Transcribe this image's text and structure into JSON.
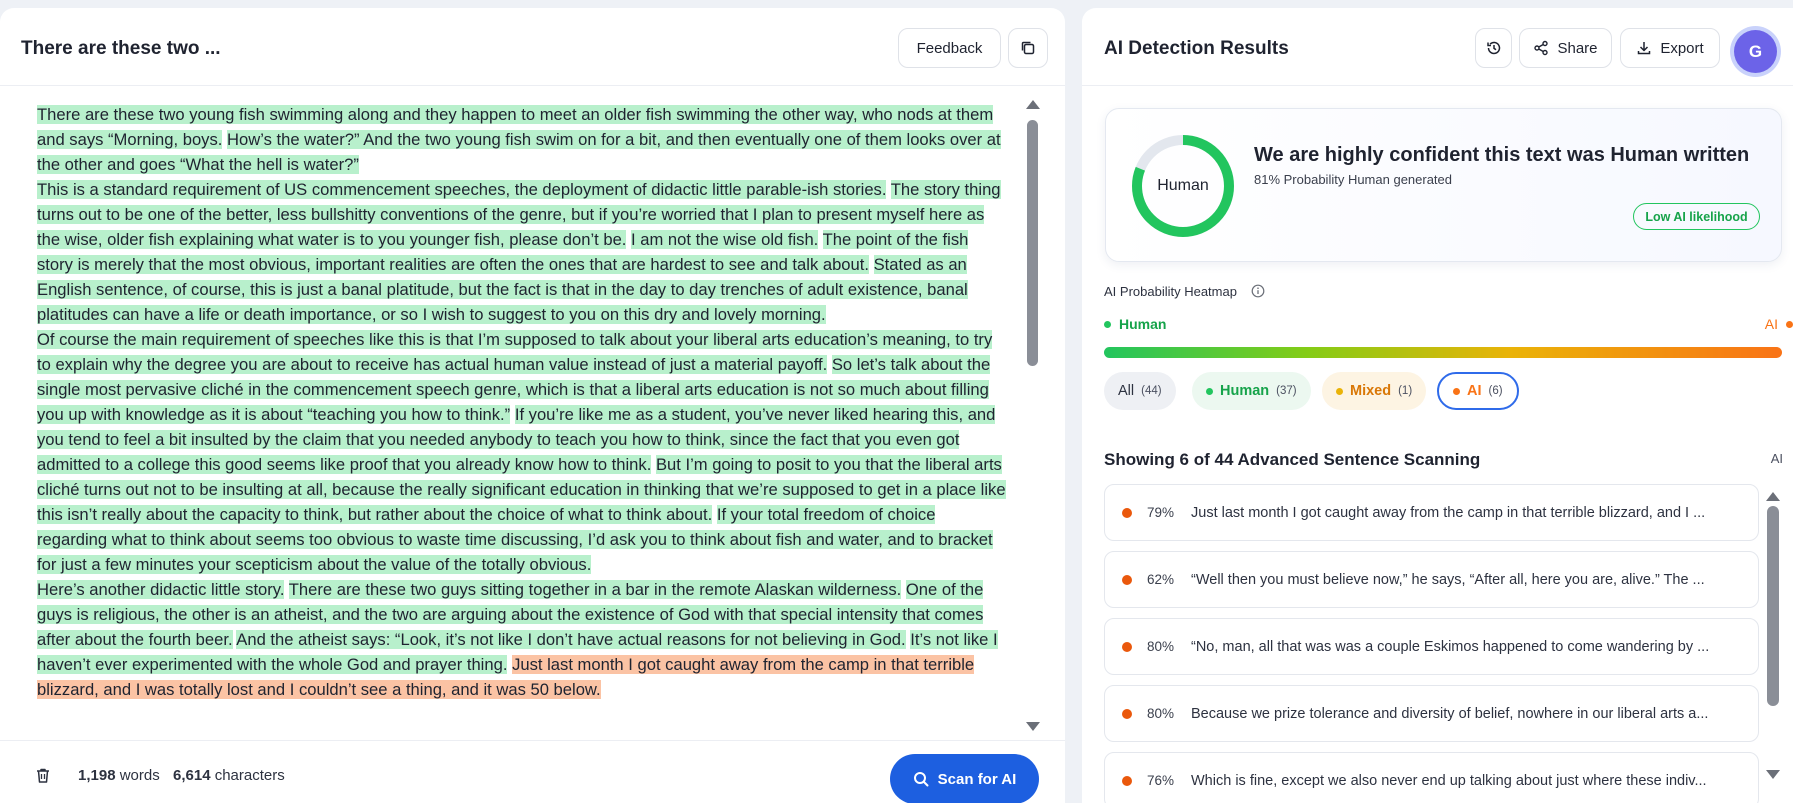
{
  "left": {
    "title": "There are these two ...",
    "feedback_label": "Feedback",
    "paragraphs": [
      [
        {
          "t": "There are these two young fish swimming along and they happen to meet an older fish swimming the other way, who nods at them and says “Morning, boys.",
          "c": "h"
        },
        {
          "t": " ",
          "c": ""
        },
        {
          "t": "How’s the water?” And the two young fish swim on for a bit, and then eventually one of them looks over at the other and goes “What the hell is water?”",
          "c": "h"
        }
      ],
      [
        {
          "t": "This is a standard requirement of US commencement speeches, the deployment of didactic little parable-ish stories.",
          "c": "h"
        },
        {
          "t": " ",
          "c": ""
        },
        {
          "t": "The story thing turns out to be one of the better, less bullshitty conventions of the genre, but if you’re worried that I plan to present myself here as the wise, older fish explaining what water is to you younger fish, please don’t be.",
          "c": "h"
        },
        {
          "t": " ",
          "c": ""
        },
        {
          "t": "I am not the wise old fish.",
          "c": "h"
        },
        {
          "t": " ",
          "c": ""
        },
        {
          "t": "The point of the fish story is merely that the most obvious, important realities are often the ones that are hardest to see and talk about.",
          "c": "h"
        },
        {
          "t": " ",
          "c": ""
        },
        {
          "t": "Stated as an English sentence, of course, this is just a banal platitude, but the fact is that in the day to day trenches of adult existence, banal platitudes can have a life or death importance, or so I wish to suggest to you on this dry and lovely morning.",
          "c": "h"
        }
      ],
      [
        {
          "t": "Of course the main requirement of speeches like this is that I’m supposed to talk about your liberal arts education’s mean­ing, to try to explain why the degree you are about to receive has actual human value instead of just a material payoff.",
          "c": "h"
        },
        {
          "t": " ",
          "c": ""
        },
        {
          "t": "So let’s talk about the single most pervasive cliché in the commencement speech genre, which is that a liberal arts education is not so much about filling you up with knowledge as it is about “teaching you how to think.”",
          "c": "h"
        },
        {
          "t": " ",
          "c": ""
        },
        {
          "t": "If you’re like me as a student, you’ve never liked hearing this, and you tend to feel a bit insulted by the claim that you needed anybody to teach you how to think, since the fact that you even got admitted to a college this good seems like proof that you already know how to think.",
          "c": "h"
        },
        {
          "t": " ",
          "c": ""
        },
        {
          "t": "But I’m going to posit to you that the liberal arts cliché turns out not to be insulting at all, because the really signifi­cant education in thinking that we’re supposed to get in a place like this isn’t really about the capacity to think, but rather about the choice of what to think about.",
          "c": "h"
        },
        {
          "t": " ",
          "c": ""
        },
        {
          "t": "If your total freedom of choice regarding what to think about seems too obvious to waste time discussing, I’d ask you to think about fish and water, and to bracket for just a few minutes your scepticism about the value of the totally obvious.",
          "c": "h"
        }
      ],
      [
        {
          "t": "Here’s another didactic little story.",
          "c": "h"
        },
        {
          "t": " ",
          "c": ""
        },
        {
          "t": "There are these two guys sitting together in a bar in the remote Alaskan wilderness.",
          "c": "h"
        },
        {
          "t": " ",
          "c": ""
        },
        {
          "t": "One of the guys is religious, the other is an atheist, and the two are arguing about the existence of God with that special inten­sity that comes after about the fourth beer.",
          "c": "h"
        },
        {
          "t": " ",
          "c": ""
        },
        {
          "t": "And the atheist says: “Look, it’s not like I don’t have actual reasons for not be­lieving in God.",
          "c": "h"
        },
        {
          "t": " ",
          "c": ""
        },
        {
          "t": "It’s not like I haven’t ever experimented with the whole God and prayer thing.",
          "c": "h"
        },
        {
          "t": " ",
          "c": ""
        },
        {
          "t": "Just last month I got caught away from the camp in that terrible blizzard, and I was totally lost and I couldn’t see a thing, and it was 50 below.",
          "c": "a"
        }
      ]
    ],
    "footer": {
      "words_num": "1,198",
      "words_label": "words",
      "chars_num": "6,614",
      "chars_label": "characters",
      "scan_label": "Scan for AI"
    }
  },
  "right": {
    "title": "AI Detection Results",
    "share_label": "Share",
    "export_label": "Export",
    "avatar_initial": "G",
    "confidence": {
      "donut_label": "Human",
      "human_probability": 81,
      "headline": "We are highly confident this text was Human written",
      "subline": "81% Probability Human generated",
      "badge": "Low AI likelihood"
    },
    "heatmap": {
      "title": "AI Probability Heatmap",
      "left_label": "Human",
      "right_label": "AI"
    },
    "filters": [
      {
        "label": "All",
        "count": "(44)"
      },
      {
        "label": "Human",
        "count": "(37)"
      },
      {
        "label": "Mixed",
        "count": "(1)"
      },
      {
        "label": "AI",
        "count": "(6)"
      }
    ],
    "showing_label": "Showing 6 of 44 Advanced Sentence Scanning",
    "ai_tag": "AI",
    "sentences": [
      {
        "pct": "79%",
        "text": "Just last month I got caught away from the camp in that terrible blizzard, and I ..."
      },
      {
        "pct": "62%",
        "text": "“Well then you must believe now,” he says, “After all, here you are, alive.” The ..."
      },
      {
        "pct": "80%",
        "text": "“No, man, all that was was a couple Eskimos happened to come wandering by ..."
      },
      {
        "pct": "80%",
        "text": "Because we prize tolerance and diversity of belief, nowhere in our liberal arts a..."
      },
      {
        "pct": "76%",
        "text": "Which is fine, except we also never end up talking about just where these indiv..."
      }
    ]
  },
  "colors": {
    "human": "#22c55e",
    "mixed": "#eab308",
    "ai": "#f97316",
    "accent": "#1d5fe0",
    "human_highlight": "#b8f0cc",
    "ai_highlight": "#fbc3a4"
  }
}
